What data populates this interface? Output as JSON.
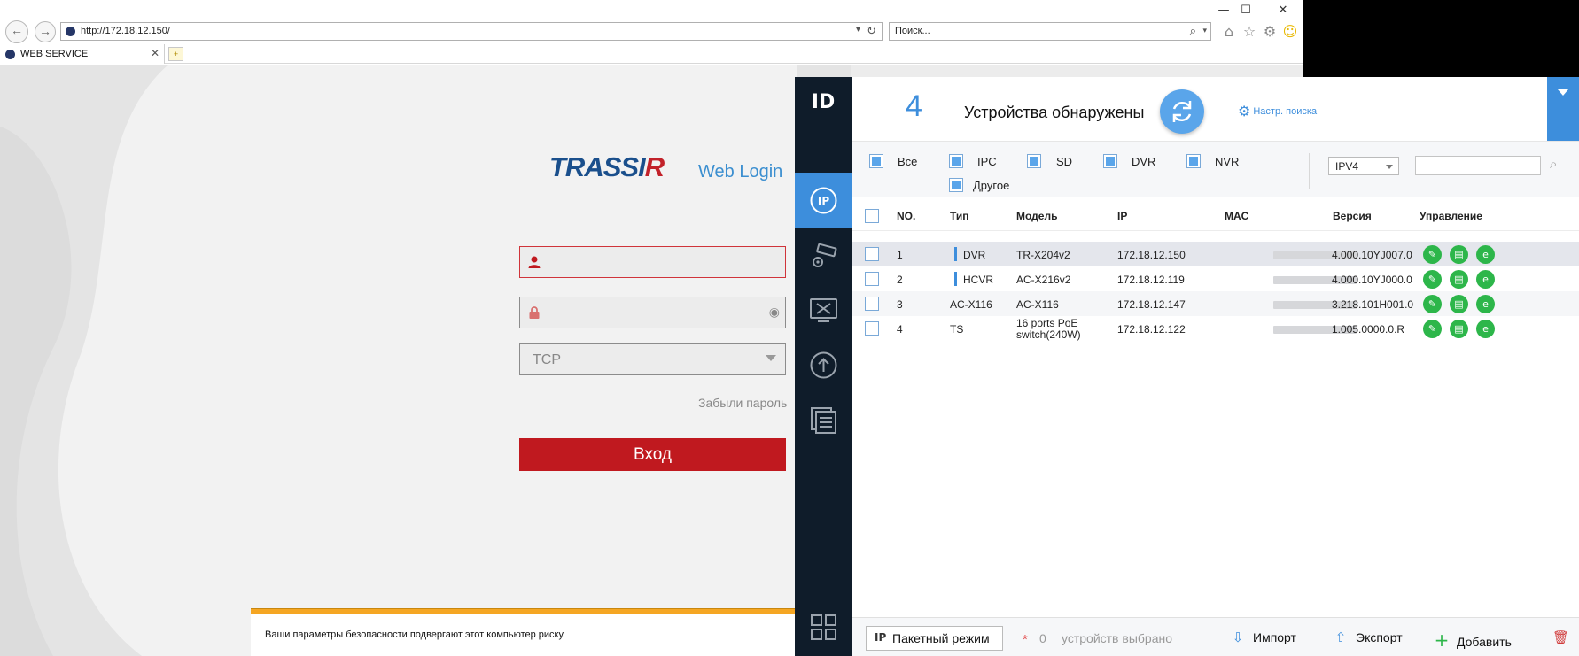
{
  "browser": {
    "url": "http://172.18.12.150/",
    "search_placeholder": "Поиск...",
    "tab_label": "WEB SERVICE",
    "window_controls": {
      "minimize": "—",
      "maximize": "☐",
      "close": "✕"
    }
  },
  "login": {
    "brand_main": "TRASSI",
    "brand_r": "R",
    "subtitle": "Web Login",
    "protocol": "TCP",
    "forgot": "Забыли пароль",
    "submit": "Вход",
    "security_message": "Ваши параметры безопасности подвергают этот компьютер риску."
  },
  "tool": {
    "logo": "ID",
    "count": "4",
    "found_label": "Устройства обнаружены",
    "search_settings": "Настр. поиска",
    "filters": [
      {
        "label": "Все",
        "checked": true
      },
      {
        "label": "IPC",
        "checked": true
      },
      {
        "label": "SD",
        "checked": true
      },
      {
        "label": "DVR",
        "checked": true
      },
      {
        "label": "NVR",
        "checked": true
      },
      {
        "label": "Другое",
        "checked": true
      }
    ],
    "ip_version": "IPV4",
    "columns": {
      "no": "NO.",
      "type": "Тип",
      "model": "Модель",
      "ip": "IP",
      "mac": "MAC",
      "version": "Версия",
      "manage": "Управление"
    },
    "rows": [
      {
        "no": "1",
        "type": "DVR",
        "model": "TR-X204v2",
        "ip": "172.18.12.150",
        "version": "4.000.10YJ007.0"
      },
      {
        "no": "2",
        "type": "HCVR",
        "model": "AC-X216v2",
        "ip": "172.18.12.119",
        "version": "4.000.10YJ000.0"
      },
      {
        "no": "3",
        "type": "AC-X116",
        "model": "AC-X116",
        "ip": "172.18.12.147",
        "version": "3.218.101H001.0"
      },
      {
        "no": "4",
        "type": "TS",
        "model_line1": "16 ports PoE",
        "model_line2": "switch(240W)",
        "ip": "172.18.12.122",
        "version": "1.005.0000.0.R"
      }
    ],
    "footer": {
      "batch_icon": "IP",
      "batch": "Пакетный режим",
      "star": "*",
      "selected_count": "0",
      "selected_label": "устройств выбрано",
      "import": "Импорт",
      "export": "Экспорт",
      "add": "Добавить"
    }
  },
  "colors": {
    "accent_blue": "#3d8edc",
    "sidebar_dark": "#0f1c2a",
    "login_red": "#c0191f",
    "action_green": "#2db64a",
    "warning_orange": "#f5a623"
  }
}
